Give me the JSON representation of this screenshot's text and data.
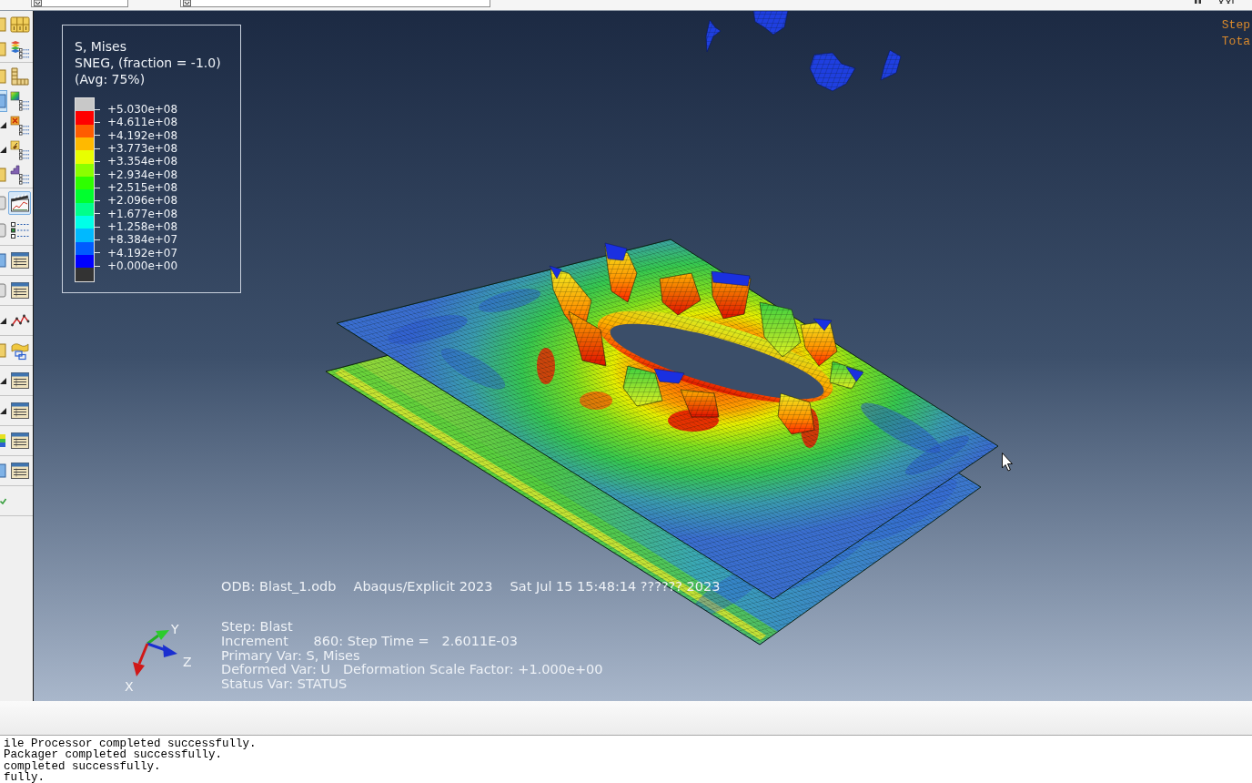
{
  "toolbox": {
    "groups": [
      {
        "rows": [
          {
            "tools": [
              {
                "kind": "yellow-cut",
                "selected": false
              },
              {
                "kind": "numbered-grid",
                "selected": false
              }
            ]
          },
          {
            "tools": [
              {
                "kind": "yellow-cut",
                "selected": false
              },
              {
                "kind": "layer-list",
                "selected": false
              }
            ]
          }
        ]
      },
      {
        "rows": [
          {
            "tools": [
              {
                "kind": "yellow-cut",
                "selected": false
              },
              {
                "kind": "element-grid",
                "selected": false
              }
            ]
          },
          {
            "tools": [
              {
                "kind": "blue-cut",
                "selected": true
              },
              {
                "kind": "gradient-list",
                "selected": false
              }
            ]
          },
          {
            "tools": [
              {
                "kind": "dark-cut",
                "selected": false
              },
              {
                "kind": "cross-list",
                "selected": false
              }
            ]
          },
          {
            "tools": [
              {
                "kind": "dark-cut",
                "selected": false
              },
              {
                "kind": "probe-list",
                "selected": false
              }
            ]
          },
          {
            "tools": [
              {
                "kind": "yellow-cut",
                "selected": false
              },
              {
                "kind": "stair-list",
                "selected": false
              }
            ]
          }
        ]
      },
      {
        "rows": [
          {
            "tools": [
              {
                "kind": "grey-cut",
                "selected": false
              },
              {
                "kind": "animation",
                "selected": true
              }
            ]
          },
          {
            "tools": [
              {
                "kind": "grey-cut",
                "selected": false
              },
              {
                "kind": "checkbox-list",
                "selected": false
              }
            ]
          }
        ]
      },
      {
        "rows": [
          {
            "tools": [
              {
                "kind": "blue-cut",
                "selected": false
              },
              {
                "kind": "table",
                "selected": false
              }
            ]
          }
        ]
      },
      {
        "rows": [
          {
            "tools": [
              {
                "kind": "grey-cut",
                "selected": false
              },
              {
                "kind": "table",
                "selected": false
              }
            ]
          }
        ]
      },
      {
        "rows": [
          {
            "tools": [
              {
                "kind": "dark-cut",
                "selected": false
              },
              {
                "kind": "xy-plot",
                "selected": false
              }
            ]
          }
        ]
      },
      {
        "rows": [
          {
            "tools": [
              {
                "kind": "yellow-cut",
                "selected": false
              },
              {
                "kind": "sheet-stack",
                "selected": false
              }
            ]
          }
        ]
      },
      {
        "rows": [
          {
            "tools": [
              {
                "kind": "dark-cut",
                "selected": false
              },
              {
                "kind": "table",
                "selected": false
              }
            ]
          }
        ]
      },
      {
        "rows": [
          {
            "tools": [
              {
                "kind": "dark-cut",
                "selected": false
              },
              {
                "kind": "table",
                "selected": false
              }
            ]
          }
        ]
      },
      {
        "rows": [
          {
            "tools": [
              {
                "kind": "contour-cut",
                "selected": false
              },
              {
                "kind": "table",
                "selected": false
              }
            ]
          }
        ]
      },
      {
        "rows": [
          {
            "tools": [
              {
                "kind": "blue-cut",
                "selected": false
              },
              {
                "kind": "table",
                "selected": false
              }
            ]
          }
        ]
      },
      {
        "rows": [
          {
            "tools": [
              {
                "kind": "tick-cut",
                "selected": false
              }
            ]
          }
        ]
      }
    ]
  },
  "viewport": {
    "legend": {
      "title_lines": [
        "S, Mises",
        "SNEG, (fraction = -1.0)",
        "(Avg: 75%)"
      ],
      "bands": [
        {
          "color": "#c8c8c8"
        },
        {
          "color": "#ff0000"
        },
        {
          "color": "#ff5c00"
        },
        {
          "color": "#ffb900"
        },
        {
          "color": "#e8ff00"
        },
        {
          "color": "#8bff00"
        },
        {
          "color": "#2eff00"
        },
        {
          "color": "#00ff2e"
        },
        {
          "color": "#00ff8b"
        },
        {
          "color": "#00ffe8"
        },
        {
          "color": "#00b9ff"
        },
        {
          "color": "#005cff"
        },
        {
          "color": "#0000ff"
        },
        {
          "color": "#333333"
        }
      ],
      "ticks": [
        "+5.030e+08",
        "+4.611e+08",
        "+4.192e+08",
        "+3.773e+08",
        "+3.354e+08",
        "+2.934e+08",
        "+2.515e+08",
        "+2.096e+08",
        "+1.677e+08",
        "+1.258e+08",
        "+8.384e+07",
        "+4.192e+07",
        "+0.000e+00"
      ]
    },
    "corner_text": [
      "Step",
      "Tota"
    ],
    "triad": {
      "axes": [
        {
          "label": "Y"
        },
        {
          "label": "Z"
        },
        {
          "label": "X"
        }
      ]
    },
    "title_block": [
      "ODB: Blast_1.odb",
      "Abaqus/Explicit 2023",
      "Sat Jul 15 15:48:14 ?????? 2023"
    ],
    "state_block": [
      "Step: Blast",
      "Increment      860: Step Time =   2.6011E-03",
      "Primary Var: S, Mises",
      "Deformed Var: U   Deformation Scale Factor: +1.000e+00",
      "Status Var: STATUS"
    ]
  },
  "message_area": {
    "lines": [
      "ile Processor completed successfully.",
      "Packager completed successfully.",
      "completed successfully.",
      "fully."
    ]
  }
}
